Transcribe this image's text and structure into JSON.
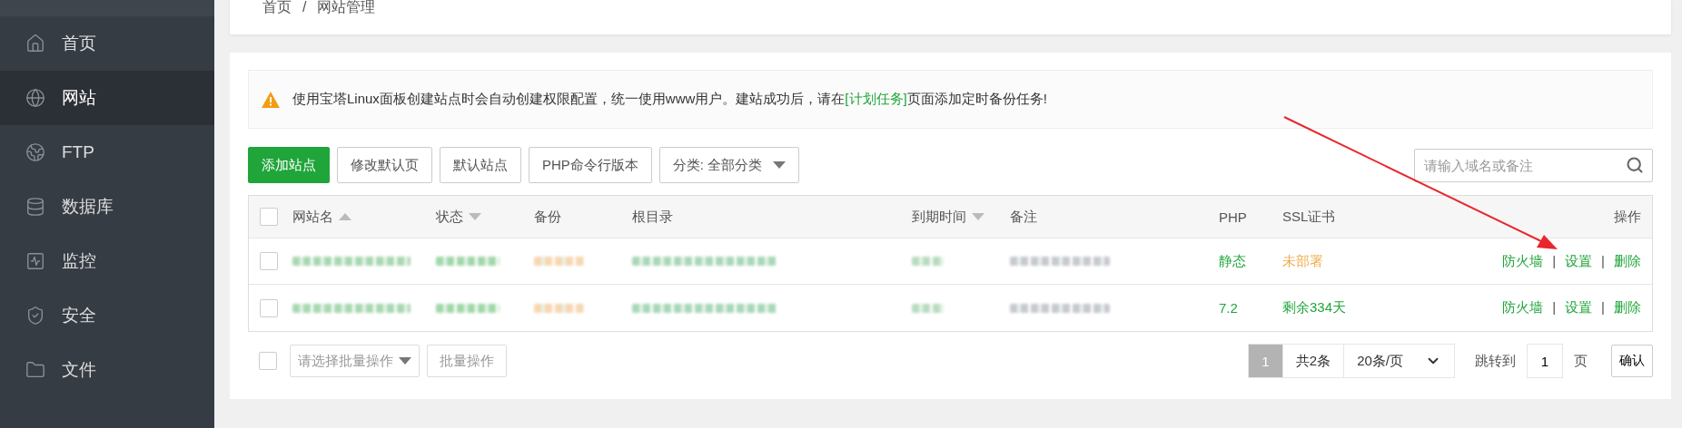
{
  "sidebar": {
    "items": [
      {
        "label": "首页",
        "selected": false
      },
      {
        "label": "网站",
        "selected": true
      },
      {
        "label": "FTP",
        "selected": false
      },
      {
        "label": "数据库",
        "selected": false
      },
      {
        "label": "监控",
        "selected": false
      },
      {
        "label": "安全",
        "selected": false
      },
      {
        "label": "文件",
        "selected": false
      }
    ]
  },
  "breadcrumb": {
    "items": [
      "首页",
      "网站管理"
    ],
    "separator": "/"
  },
  "notice": {
    "text_before": "使用宝塔Linux面板创建站点时会自动创建权限配置，统一使用www用户。建站成功后，请在",
    "link": "[计划任务]",
    "text_after": "页面添加定时备份任务!"
  },
  "toolbar": {
    "buttons": [
      {
        "label": "添加站点",
        "kind": "primary"
      },
      {
        "label": "修改默认页",
        "kind": "default"
      },
      {
        "label": "默认站点",
        "kind": "default"
      },
      {
        "label": "PHP命令行版本",
        "kind": "default"
      },
      {
        "label": "分类: 全部分类",
        "kind": "dropdown"
      }
    ],
    "search": {
      "placeholder": "请输入域名或备注"
    }
  },
  "table": {
    "header_checked": false,
    "columns": [
      {
        "label": "网站名",
        "sortable": true,
        "ascending": true,
        "kind": "blurred"
      },
      {
        "label": "状态",
        "sortable": true,
        "ascending": false,
        "kind": "blurred"
      },
      {
        "label": "备份",
        "sortable": false,
        "kind": "blurred"
      },
      {
        "label": "根目录",
        "sortable": false,
        "kind": "blurred"
      },
      {
        "label": "到期时间",
        "sortable": true,
        "ascending": false,
        "kind": "blurred"
      },
      {
        "label": "备注",
        "sortable": false,
        "kind": "blurred"
      },
      {
        "label": "PHP",
        "sortable": false,
        "kind": "php"
      },
      {
        "label": "SSL证书",
        "sortable": false,
        "kind": "ssl"
      },
      {
        "label": "操作",
        "sortable": false,
        "kind": "actions"
      }
    ],
    "rows": [
      {
        "checked": false,
        "php": "静态",
        "ssl": {
          "text": "未部署",
          "color": "#f0ad4e"
        },
        "actions": [
          "防火墙",
          "设置",
          "删除"
        ],
        "separators": [
          "|",
          "|"
        ]
      },
      {
        "checked": false,
        "php": "7.2",
        "ssl": {
          "text": "剩余334天",
          "color": "#20a53a"
        },
        "actions": [
          "防火墙",
          "设置",
          "删除"
        ],
        "separators": [
          "|",
          "|"
        ]
      }
    ]
  },
  "footer": {
    "select_all_checked": false,
    "batch_select": {
      "placeholder": "请选择批量操作"
    },
    "batch_button": {
      "label": "批量操作",
      "disabled": true
    },
    "pagination": {
      "pages": [
        {
          "label": "1",
          "selected": true
        }
      ],
      "total": "共2条",
      "page_size": "20条/页",
      "jump_label": "跳转到",
      "jump_value": "1",
      "page_unit": "页",
      "confirm": "确认"
    }
  }
}
